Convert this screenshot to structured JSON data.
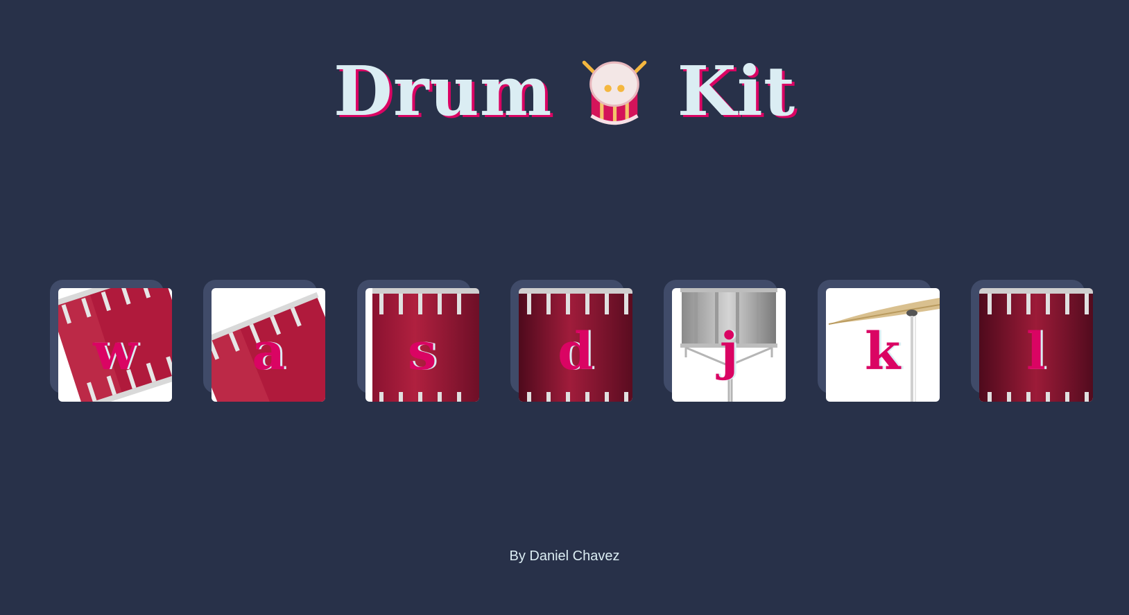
{
  "title": {
    "word1": "Drum",
    "icon": "drum-emoji-icon",
    "word2": "Kit"
  },
  "keys": [
    {
      "letter": "w",
      "drum": "tom-1"
    },
    {
      "letter": "a",
      "drum": "tom-2"
    },
    {
      "letter": "s",
      "drum": "tom-3"
    },
    {
      "letter": "d",
      "drum": "tom-4"
    },
    {
      "letter": "j",
      "drum": "snare"
    },
    {
      "letter": "k",
      "drum": "crash"
    },
    {
      "letter": "l",
      "drum": "kick-bass"
    }
  ],
  "footer": {
    "credit": "By Daniel Chavez"
  },
  "colors": {
    "background": "#283149",
    "key_border": "#404b69",
    "accent": "#da0463",
    "light": "#dbedf3"
  }
}
